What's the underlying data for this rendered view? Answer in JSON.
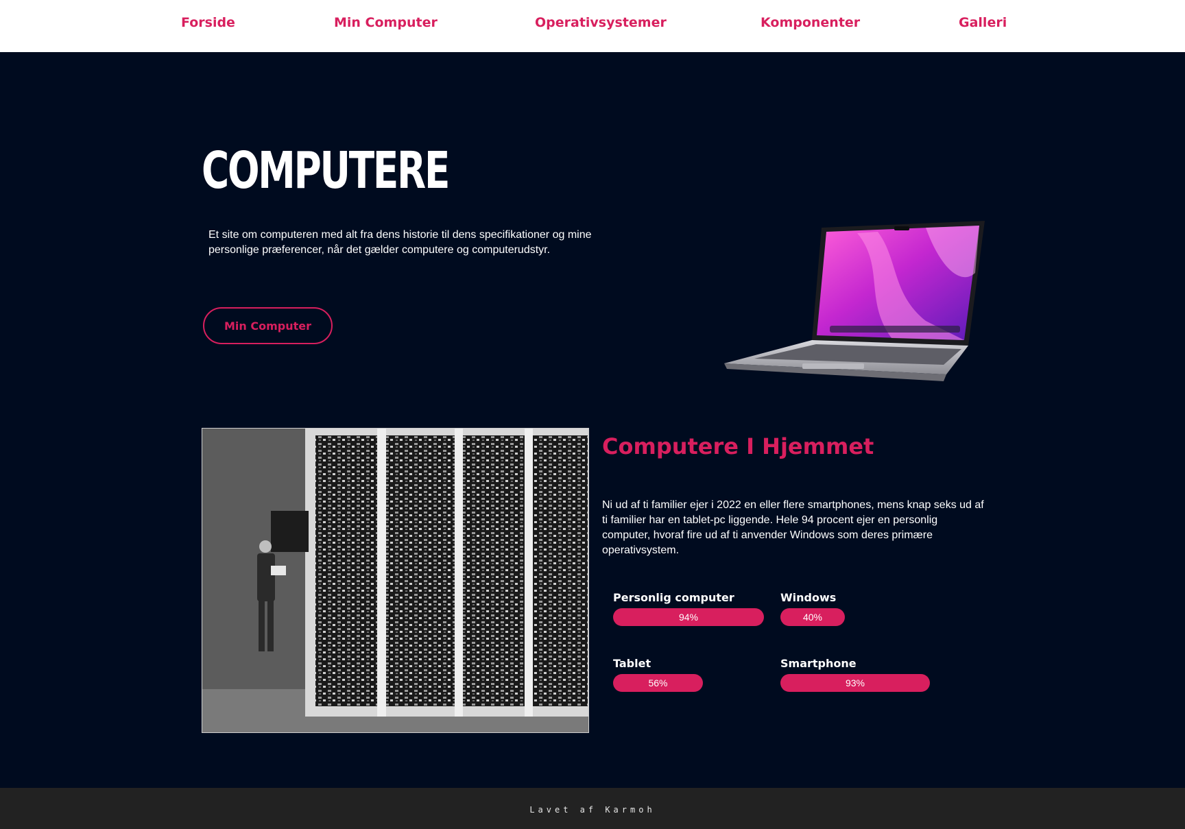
{
  "nav": {
    "items": [
      {
        "label": "Forside"
      },
      {
        "label": "Min Computer"
      },
      {
        "label": "Operativsystemer"
      },
      {
        "label": "Komponenter"
      },
      {
        "label": "Galleri"
      }
    ]
  },
  "hero": {
    "title": "COMPUTERE",
    "text": "Et site om computeren med alt fra dens historie til dens specifikationer og mine personlige præferencer, når det gælder computere og computerudstyr.",
    "button_label": "Min Computer"
  },
  "home_section": {
    "title": "Computere I Hjemmet",
    "text": "Ni ud af ti familier ejer i 2022 en eller flere smartphones, mens knap seks ud af ti familier har en tablet-pc liggende. Hele 94 procent ejer en personlig computer, hvoraf fire ud af ti anvender Windows som deres primære operativsystem.",
    "stats": [
      {
        "label": "Personlig computer",
        "value": "94%",
        "percent": 94
      },
      {
        "label": "Windows",
        "value": "40%",
        "percent": 40
      },
      {
        "label": "Tablet",
        "value": "56%",
        "percent": 56
      },
      {
        "label": "Smartphone",
        "value": "93%",
        "percent": 93
      }
    ]
  },
  "footer": {
    "text": "Lavet af Karmoh"
  },
  "colors": {
    "accent": "#d81f5e",
    "background": "#000b1f",
    "nav_background": "#ffffff",
    "footer_background": "#222222"
  },
  "icons": {
    "laptop": "laptop-image",
    "photo": "historic-computer-photo"
  }
}
